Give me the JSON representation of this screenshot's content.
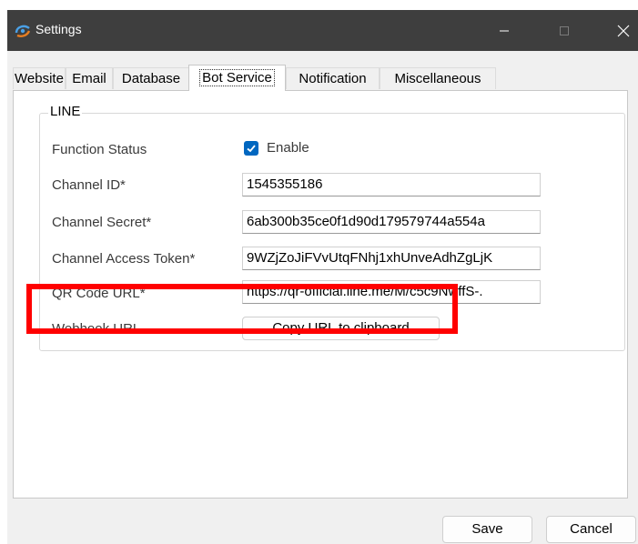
{
  "window": {
    "title": "Settings",
    "controls": {
      "minimize_icon": "minimize-icon",
      "maximize_icon": "maximize-icon",
      "close_icon": "close-icon"
    },
    "titlebar_color": "#3e3e3e"
  },
  "tabs": [
    {
      "label": "Website"
    },
    {
      "label": "Email"
    },
    {
      "label": "Database"
    },
    {
      "label": "Bot Service",
      "active": true
    },
    {
      "label": "Notification"
    },
    {
      "label": "Miscellaneous"
    }
  ],
  "line_group": {
    "title": "LINE",
    "function_status": {
      "label": "Function Status",
      "checkbox_label": "Enable",
      "checked": true
    },
    "channel_id": {
      "label": "Channel ID*",
      "value": "1545355186"
    },
    "channel_secret": {
      "label": "Channel Secret*",
      "value": "6ab300b35ce0f1d90d179579744a554a"
    },
    "channel_access_token": {
      "label": "Channel Access Token*",
      "value": "9WZjZoJiFVvUtqFNhj1xhUnveAdhZgLjK"
    },
    "qr_code_url": {
      "label": "QR Code URL*",
      "value": "https://qr-official.line.me/M/c5c9NwffS-."
    },
    "webhook_url": {
      "label": "Webhook URL",
      "button_label": "Copy URL to clipboard"
    }
  },
  "footer": {
    "save_label": "Save",
    "cancel_label": "Cancel"
  },
  "colors": {
    "accent": "#0067c0",
    "highlight": "#ff0000"
  }
}
